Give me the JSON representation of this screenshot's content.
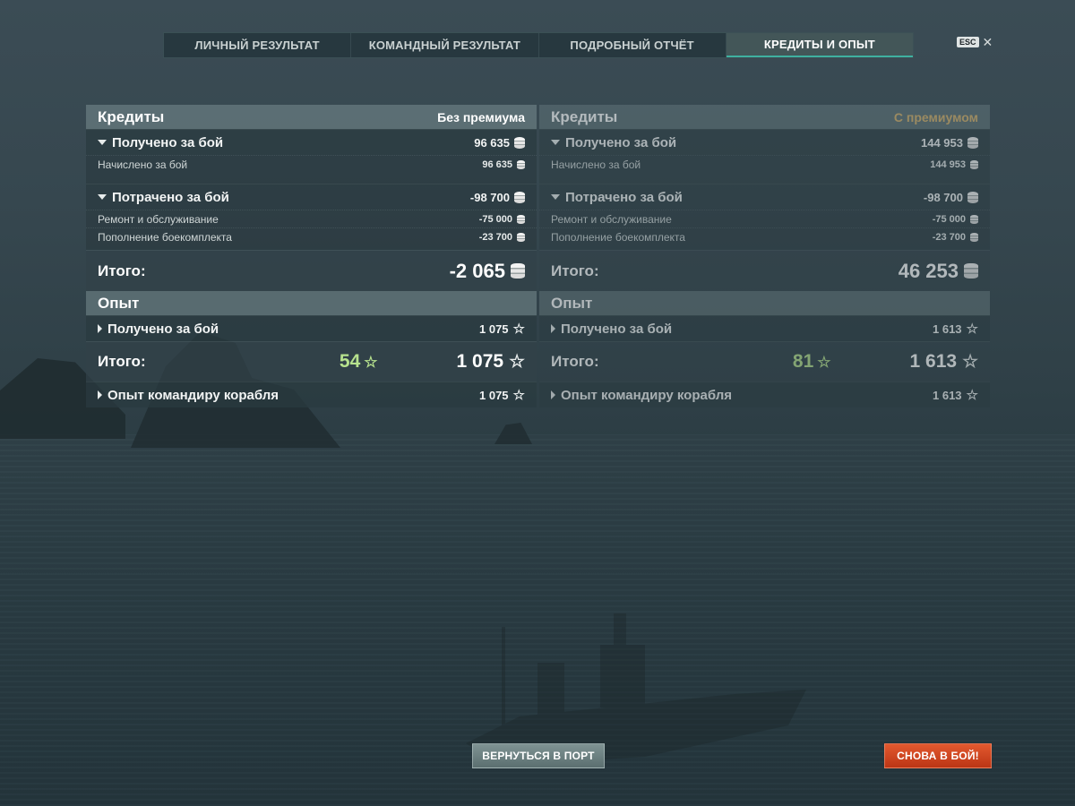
{
  "tabs": [
    {
      "label": "ЛИЧНЫЙ РЕЗУЛЬТАТ",
      "active": false
    },
    {
      "label": "КОМАНДНЫЙ РЕЗУЛЬТАТ",
      "active": false
    },
    {
      "label": "ПОДРОБНЫЙ ОТЧЁТ",
      "active": false
    },
    {
      "label": "КРЕДИТЫ И ОПЫТ",
      "active": true
    }
  ],
  "esc": {
    "key": "ESC",
    "close": "✕"
  },
  "left": {
    "credits_title": "Кредиты",
    "mode": "Без премиума",
    "earned_label": "Получено за бой",
    "earned_value": "96 635",
    "accrued_label": "Начислено за бой",
    "accrued_value": "96 635",
    "spent_label": "Потрачено за бой",
    "spent_value": "-98 700",
    "repair_label": "Ремонт и обслуживание",
    "repair_value": "-75 000",
    "ammo_label": "Пополнение боекомплекта",
    "ammo_value": "-23 700",
    "total_label": "Итого:",
    "total_value": "-2 065",
    "xp_title": "Опыт",
    "xp_earned_label": "Получено за бой",
    "xp_earned_value": "1 075",
    "xp_total_label": "Итого:",
    "xp_base_value": "54",
    "xp_total_value": "1 075",
    "commander_label": "Опыт командиру корабля",
    "commander_value": "1 075"
  },
  "right": {
    "credits_title": "Кредиты",
    "mode": "С премиумом",
    "earned_label": "Получено за бой",
    "earned_value": "144 953",
    "accrued_label": "Начислено за бой",
    "accrued_value": "144 953",
    "spent_label": "Потрачено за бой",
    "spent_value": "-98 700",
    "repair_label": "Ремонт и обслуживание",
    "repair_value": "-75 000",
    "ammo_label": "Пополнение боекомплекта",
    "ammo_value": "-23 700",
    "total_label": "Итого:",
    "total_value": "46 253",
    "xp_title": "Опыт",
    "xp_earned_label": "Получено за бой",
    "xp_earned_value": "1 613",
    "xp_total_label": "Итого:",
    "xp_base_value": "81",
    "xp_total_value": "1 613",
    "commander_label": "Опыт командиру корабля",
    "commander_value": "1 613"
  },
  "buttons": {
    "port": "ВЕРНУТЬСЯ В ПОРТ",
    "battle": "СНОВА В БОЙ!"
  },
  "icons": {
    "credits": "credits-coin-icon",
    "xp": "star-icon",
    "expand": "triangle-down-icon",
    "collapse": "triangle-right-icon"
  },
  "colors": {
    "accent_premium": "#d7b26b",
    "xp_base": "#b7e28e",
    "battle_button": "#d8481f",
    "active_tab_underline": "#3fb0a0"
  }
}
